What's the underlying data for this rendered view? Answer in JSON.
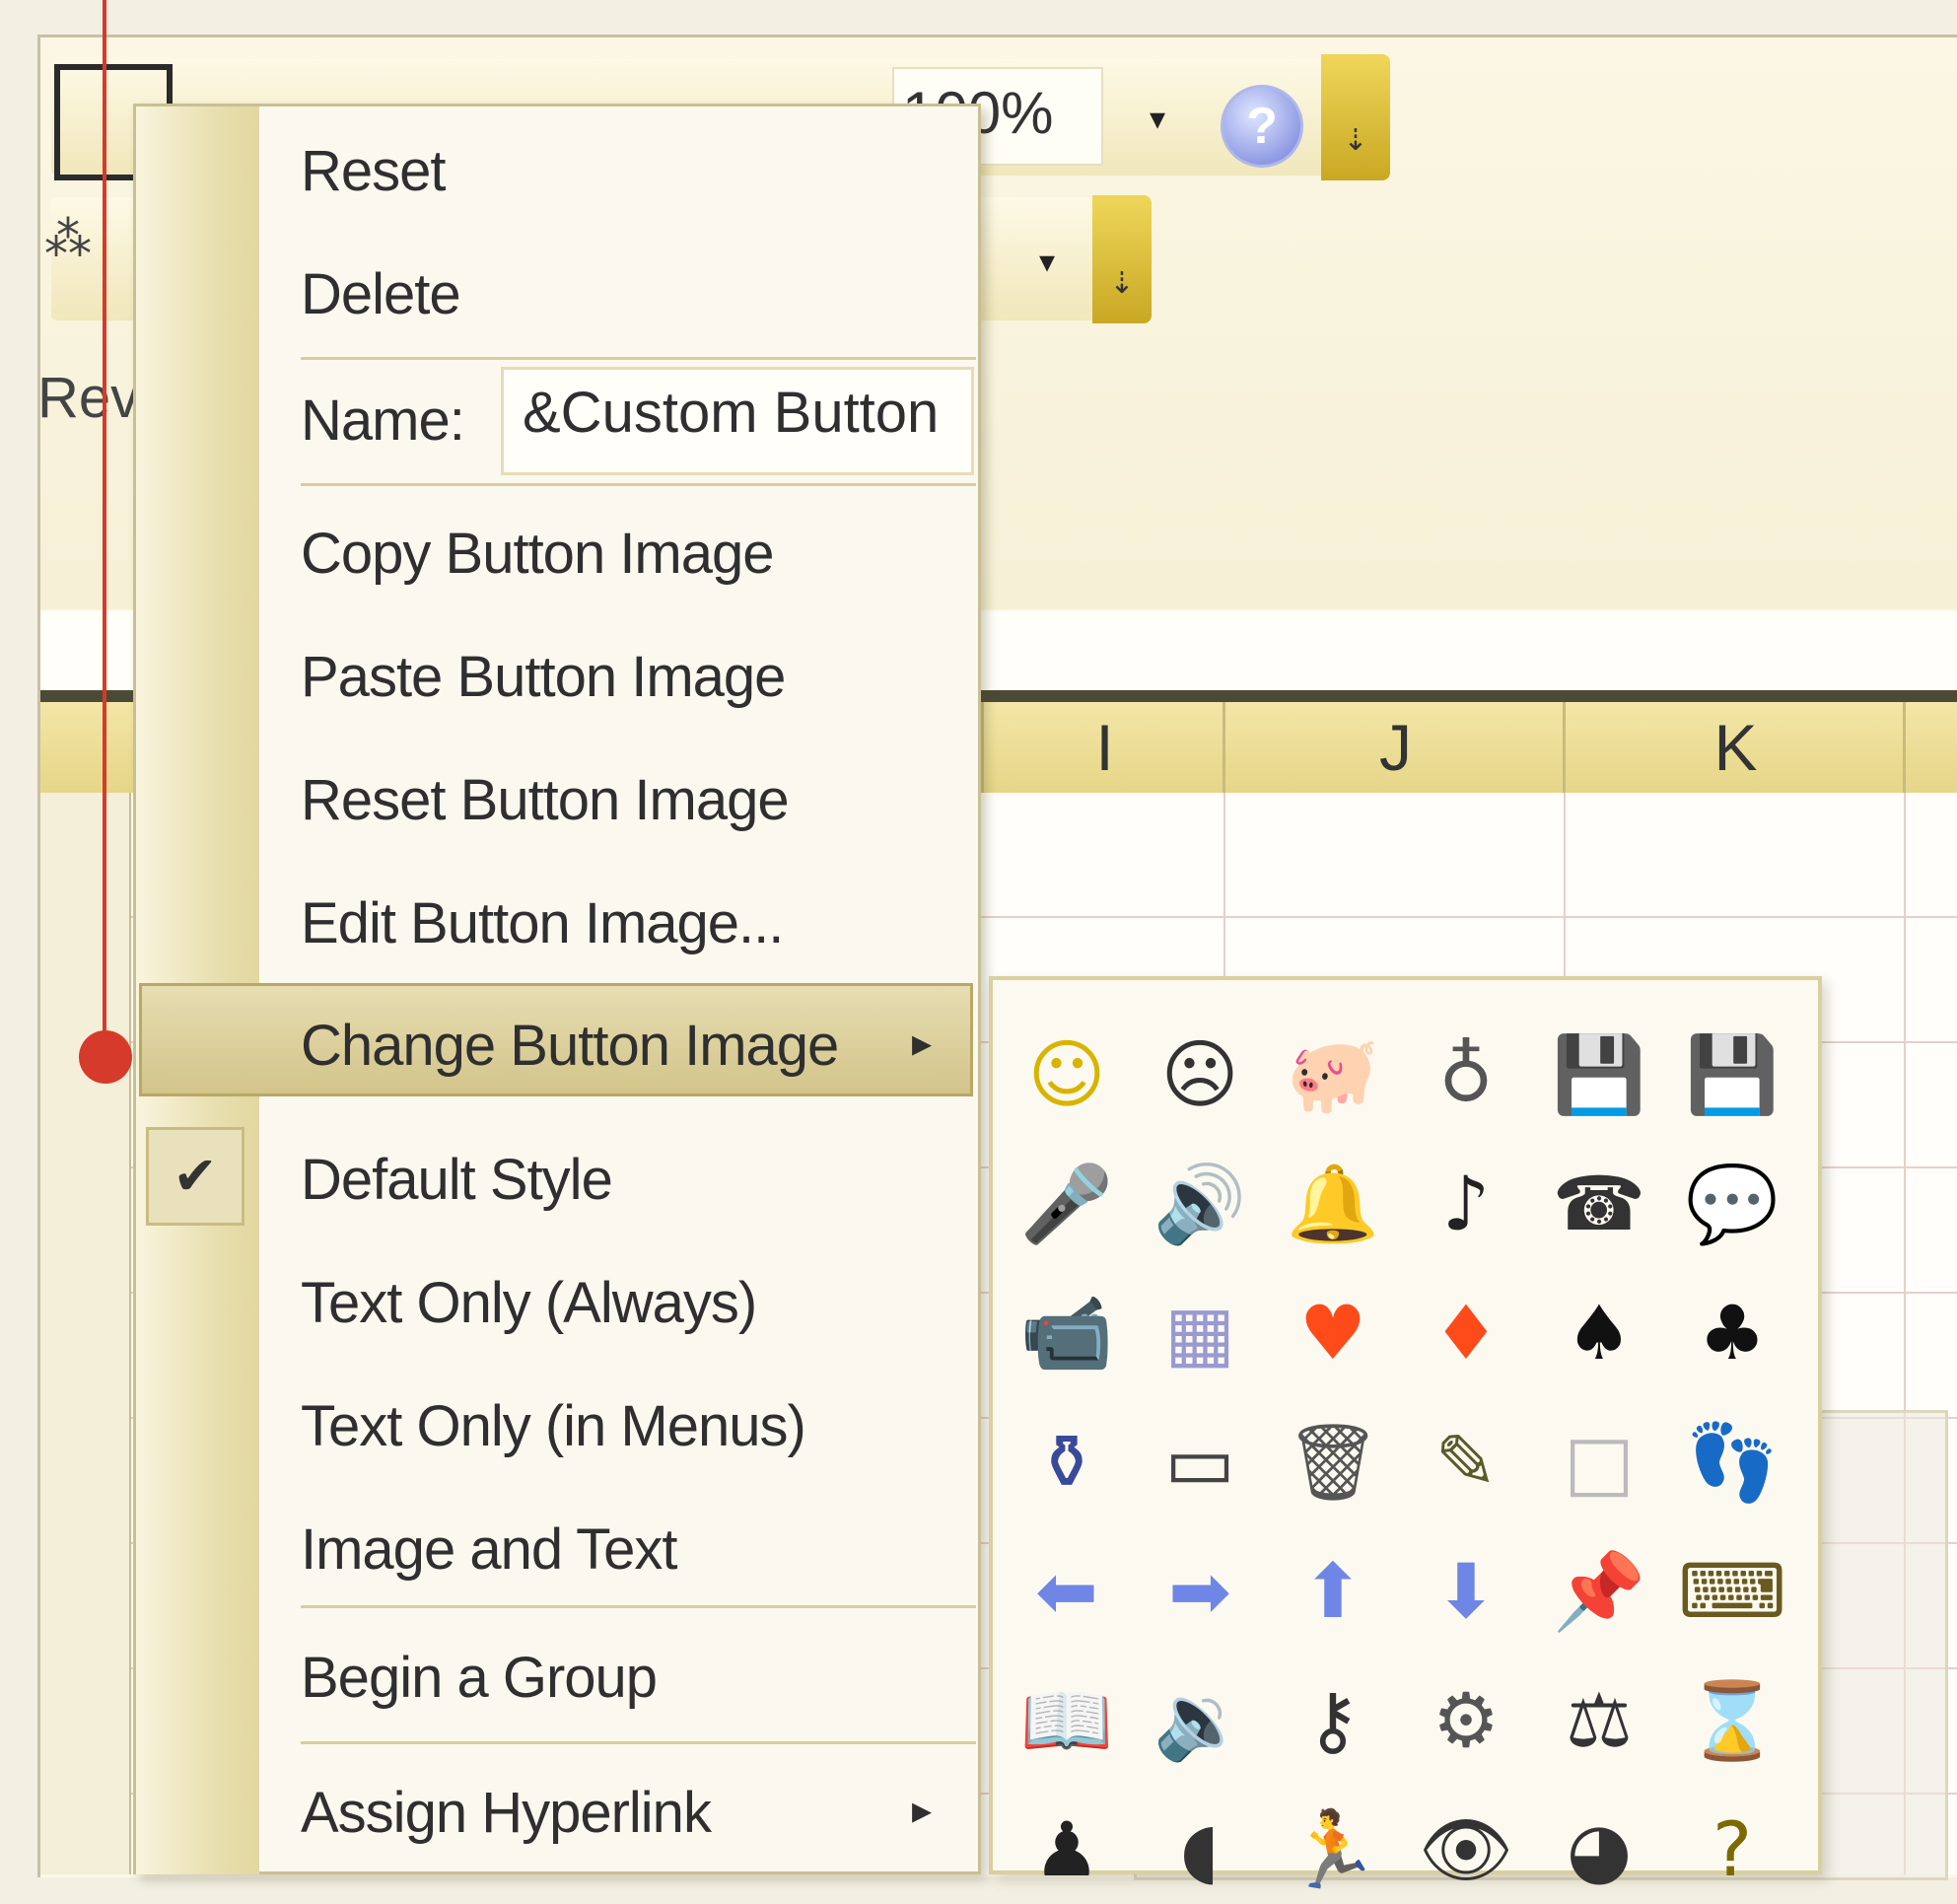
{
  "toolbar": {
    "zoom_value": "100%",
    "help_icon": "help-icon",
    "rev_fragment": "Rev"
  },
  "columns": [
    "I",
    "J",
    "K"
  ],
  "context_menu": {
    "reset": "Reset",
    "delete": "Delete",
    "name_label": "Name:",
    "name_value": "&Custom Button",
    "copy_image": "Copy Button Image",
    "paste_image": "Paste Button Image",
    "reset_image": "Reset Button Image",
    "edit_image": "Edit Button Image...",
    "change_image": "Change Button Image",
    "default_style": "Default Style",
    "text_only_always": "Text Only (Always)",
    "text_only_menus": "Text Only (in Menus)",
    "image_and_text": "Image and Text",
    "begin_group": "Begin a Group",
    "assign_hyperlink": "Assign Hyperlink"
  },
  "palette_icons": [
    {
      "name": "smiley-face-icon",
      "glyph": "☺",
      "color": "#d8b400"
    },
    {
      "name": "frown-face-icon",
      "glyph": "☹",
      "color": "#333333"
    },
    {
      "name": "piggy-bank-icon",
      "glyph": "🐖",
      "color": "#8a7a70"
    },
    {
      "name": "money-bag-icon",
      "glyph": "♁",
      "color": "#555555"
    },
    {
      "name": "save-up-icon",
      "glyph": "💾",
      "color": "#7a6000"
    },
    {
      "name": "save-down-icon",
      "glyph": "💾",
      "color": "#7a6000"
    },
    {
      "name": "microphone-icon",
      "glyph": "🎤",
      "color": "#7c7cc0"
    },
    {
      "name": "speaker-icon",
      "glyph": "🔊",
      "color": "#444444"
    },
    {
      "name": "bell-icon",
      "glyph": "🔔",
      "color": "#d6a800"
    },
    {
      "name": "music-note-icon",
      "glyph": "♪",
      "color": "#222222"
    },
    {
      "name": "telephone-icon",
      "glyph": "☎",
      "color": "#333333"
    },
    {
      "name": "speech-bubble-icon",
      "glyph": "💬",
      "color": "#333333"
    },
    {
      "name": "video-camera-icon",
      "glyph": "📹",
      "color": "#444444"
    },
    {
      "name": "calculator-icon",
      "glyph": "▦",
      "color": "#9a9ad0"
    },
    {
      "name": "heart-icon",
      "glyph": "♥",
      "color": "#ff4a1a"
    },
    {
      "name": "diamond-icon",
      "glyph": "♦",
      "color": "#ff4a1a"
    },
    {
      "name": "spade-icon",
      "glyph": "♠",
      "color": "#111111"
    },
    {
      "name": "club-icon",
      "glyph": "♣",
      "color": "#111111"
    },
    {
      "name": "jar-icon",
      "glyph": "⚱",
      "color": "#3a4a9a"
    },
    {
      "name": "battery-icon",
      "glyph": "▭",
      "color": "#444444"
    },
    {
      "name": "trash-can-icon",
      "glyph": "🗑",
      "color": "#555555"
    },
    {
      "name": "pencil-icon",
      "glyph": "✎",
      "color": "#5a5a2a"
    },
    {
      "name": "blank-square-icon",
      "glyph": "□",
      "color": "#bbbbbb"
    },
    {
      "name": "footprints-icon",
      "glyph": "👣",
      "color": "#555555"
    },
    {
      "name": "arrow-left-icon",
      "glyph": "⬅",
      "color": "#6f86e6"
    },
    {
      "name": "arrow-right-icon",
      "glyph": "➡",
      "color": "#6f86e6"
    },
    {
      "name": "arrow-up-icon",
      "glyph": "⬆",
      "color": "#6f86e6"
    },
    {
      "name": "arrow-down-icon",
      "glyph": "⬇",
      "color": "#6f86e6"
    },
    {
      "name": "push-pin-icon",
      "glyph": "📌",
      "color": "#8a8a8a"
    },
    {
      "name": "keyboard-icon",
      "glyph": "⌨",
      "color": "#6a5a20"
    },
    {
      "name": "book-icon",
      "glyph": "📖",
      "color": "#444444"
    },
    {
      "name": "sound-wave-icon",
      "glyph": "🔉",
      "color": "#333333"
    },
    {
      "name": "key-icon",
      "glyph": "⚷",
      "color": "#333333"
    },
    {
      "name": "gears-icon",
      "glyph": "⚙",
      "color": "#555555"
    },
    {
      "name": "scales-icon",
      "glyph": "⚖",
      "color": "#333333"
    },
    {
      "name": "hourglass-icon",
      "glyph": "⌛",
      "color": "#555555"
    },
    {
      "name": "person-icon",
      "glyph": "♟",
      "color": "#222222"
    },
    {
      "name": "head-profile-icon",
      "glyph": "◖",
      "color": "#333333"
    },
    {
      "name": "running-man-icon",
      "glyph": "🏃",
      "color": "#555555"
    },
    {
      "name": "eye-icon",
      "glyph": "👁",
      "color": "#333333"
    },
    {
      "name": "globe-icon",
      "glyph": "◕",
      "color": "#333333"
    },
    {
      "name": "question-mark-icon",
      "glyph": "?",
      "color": "#7a6a00"
    }
  ],
  "colors": {
    "accent_yellow": "#e6d688",
    "callout_red": "#d63a2a",
    "menu_bg": "#fbf9ef"
  }
}
